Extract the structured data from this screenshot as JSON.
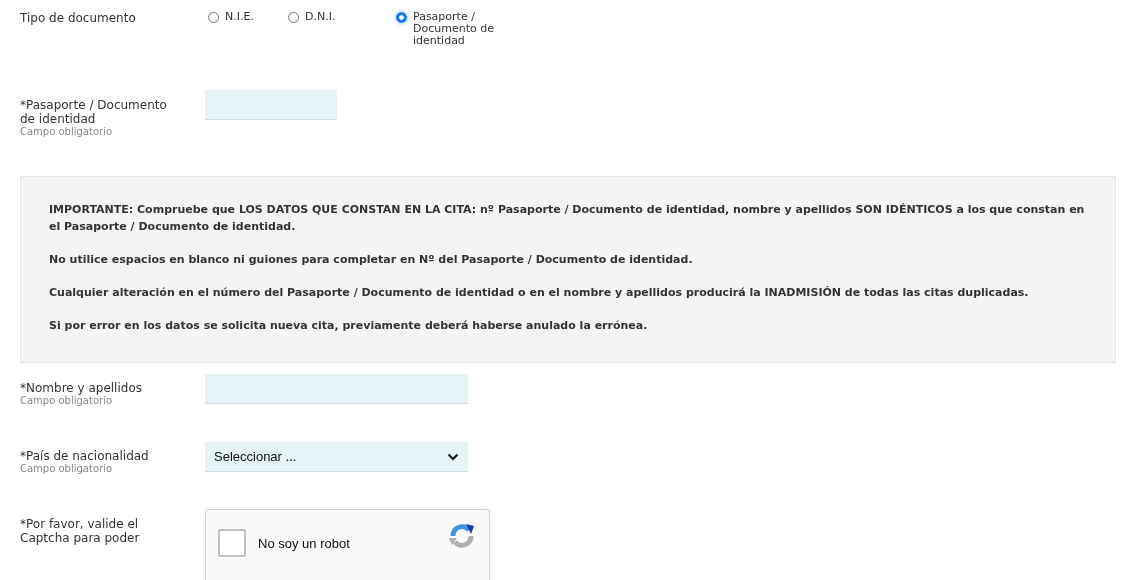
{
  "document_type": {
    "label": "Tipo de documento",
    "options": [
      {
        "label": "N.I.E.",
        "selected": false
      },
      {
        "label": "D.N.I.",
        "selected": false
      },
      {
        "label": "Pasaporte / Documento de identidad",
        "selected": true
      }
    ]
  },
  "document_number": {
    "label": "*Pasaporte / Documento de identidad",
    "hint": "Campo obligatorio"
  },
  "notice": [
    "IMPORTANTE: Compruebe que LOS DATOS QUE CONSTAN EN LA CITA: nº Pasaporte / Documento de identidad, nombre y apellidos SON IDÉNTICOS a los que constan en el Pasaporte / Documento de identidad.",
    "No utilice espacios en blanco ni guiones para completar en Nº del Pasaporte / Documento de identidad.",
    "Cualquier alteración en el número del Pasaporte / Documento de identidad o en el nombre y apellidos producirá la INADMISIÓN de todas las citas duplicadas.",
    "Si por error en los datos se solicita nueva cita, previamente deberá haberse anulado la errónea."
  ],
  "name": {
    "label": "*Nombre y apellidos",
    "hint": "Campo obligatorio"
  },
  "nationality": {
    "label": "*País de nacionalidad",
    "hint": "Campo obligatorio",
    "value": "Seleccionar ..."
  },
  "captcha": {
    "label": "*Por favor, valide el Captcha para poder",
    "checkbox_label": "No soy un robot",
    "checked": false
  }
}
